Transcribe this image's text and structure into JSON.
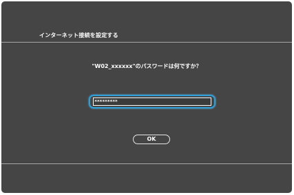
{
  "dialog": {
    "title": "インターネット接続を設定する",
    "prompt": "\"W02_xxxxxx\"のパスワードは何ですか？",
    "password_value": "*********",
    "ok_label": "OK"
  },
  "colors": {
    "background": "#454545",
    "focus": "#2e9fd8",
    "divider": "#a8a8a8",
    "text": "#ffffff"
  }
}
